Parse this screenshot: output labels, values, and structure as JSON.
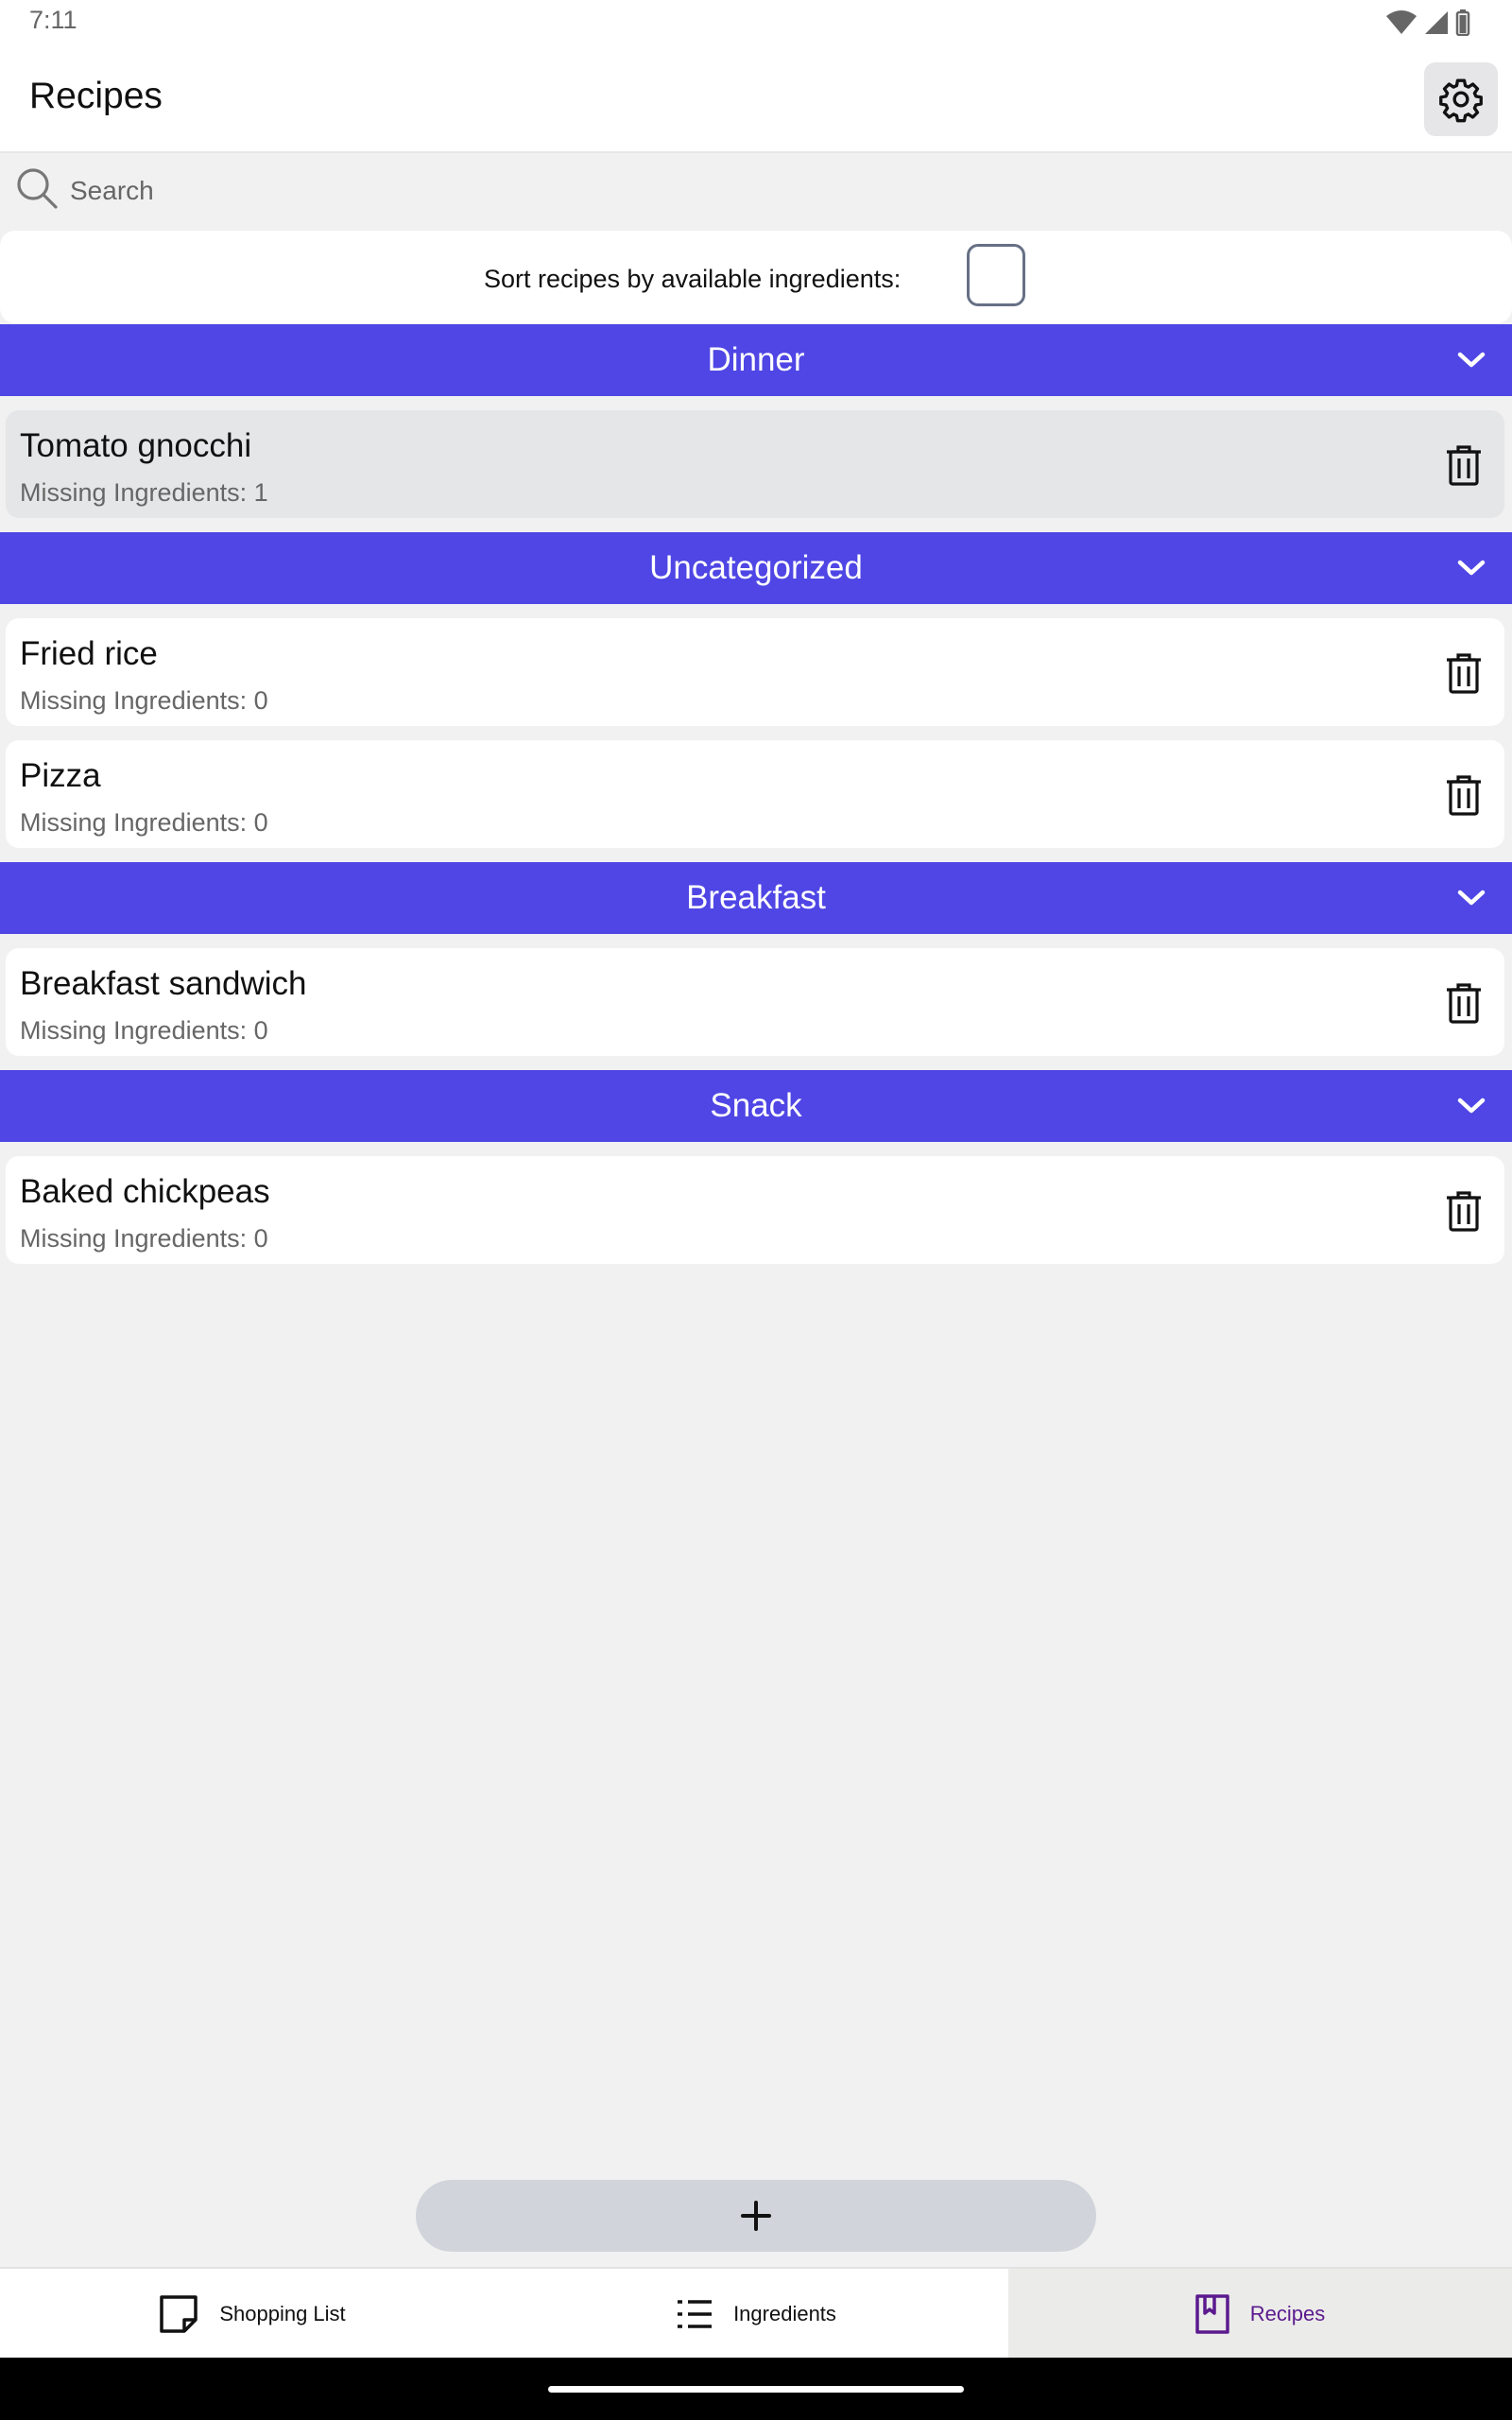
{
  "status_bar": {
    "time": "7:11"
  },
  "app_bar": {
    "title": "Recipes"
  },
  "search": {
    "placeholder": "Search",
    "value": ""
  },
  "sort": {
    "label": "Sort recipes by available ingredients:",
    "checked": false
  },
  "categories": [
    {
      "name": "Dinner",
      "recipes": [
        {
          "name": "Tomato gnocchi",
          "missing": "Missing Ingredients: 1"
        }
      ]
    },
    {
      "name": "Uncategorized",
      "recipes": [
        {
          "name": "Fried rice",
          "missing": "Missing Ingredients: 0"
        },
        {
          "name": "Pizza",
          "missing": "Missing Ingredients: 0"
        }
      ]
    },
    {
      "name": "Breakfast",
      "recipes": [
        {
          "name": "Breakfast sandwich",
          "missing": "Missing Ingredients: 0"
        }
      ]
    },
    {
      "name": "Snack",
      "recipes": [
        {
          "name": "Baked chickpeas",
          "missing": "Missing Ingredients: 0"
        }
      ]
    }
  ],
  "fab": {
    "icon": "plus-icon"
  },
  "bottom_nav": {
    "tabs": [
      {
        "label": "Shopping List",
        "icon": "note-icon",
        "active": false
      },
      {
        "label": "Ingredients",
        "icon": "list-icon",
        "active": false
      },
      {
        "label": "Recipes",
        "icon": "book-icon",
        "active": true
      }
    ]
  },
  "colors": {
    "accent": "#4f46e5",
    "active_tab_text": "#5b1a8e",
    "background": "#f1f1f1"
  }
}
